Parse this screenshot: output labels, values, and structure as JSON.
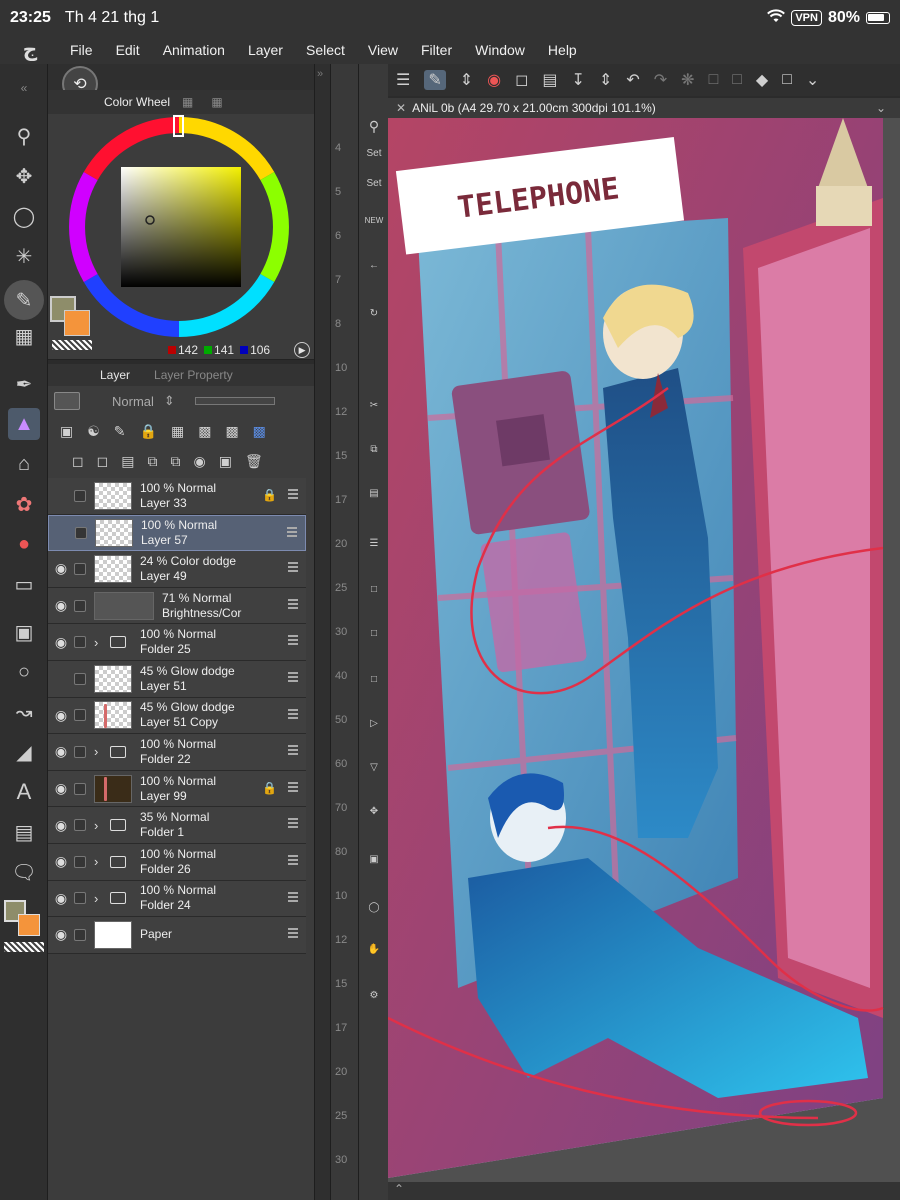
{
  "status": {
    "time": "23:25",
    "date": "Th 4 21 thg 1",
    "vpn": "VPN",
    "battery": "80%"
  },
  "menu": [
    "File",
    "Edit",
    "Animation",
    "Layer",
    "Select",
    "View",
    "Filter",
    "Window",
    "Help"
  ],
  "color_panel": {
    "tab": "Color Wheel",
    "rgb": {
      "r": "142",
      "g": "141",
      "b": "106"
    },
    "main_color": "#8e8d6a",
    "sub_color": "#f4943b"
  },
  "layer_panel": {
    "tab": "Layer",
    "tab2": "Layer Property",
    "blend_mode": "Normal",
    "layers": [
      {
        "line1": "100 % Normal",
        "line2": "Layer 33",
        "visible": false,
        "lock": true,
        "thumb": "checker"
      },
      {
        "line1": "100 % Normal",
        "line2": "Layer 57",
        "visible": false,
        "selected": true,
        "thumb": "checker"
      },
      {
        "line1": "24 % Color dodge",
        "line2": "Layer 49",
        "visible": true,
        "thumb": "checker"
      },
      {
        "line1": "71 % Normal",
        "line2": "Brightness/Cor",
        "visible": true,
        "thumb": "adjust"
      },
      {
        "line1": "100 % Normal",
        "line2": "Folder 25",
        "visible": true,
        "folder": true
      },
      {
        "line1": "45 % Glow dodge",
        "line2": "Layer 51",
        "visible": false,
        "thumb": "checker"
      },
      {
        "line1": "45 % Glow dodge",
        "line2": "Layer 51 Copy",
        "visible": true,
        "thumb": "checker",
        "red": true
      },
      {
        "line1": "100 % Normal",
        "line2": "Folder 22",
        "visible": true,
        "folder": true
      },
      {
        "line1": "100 % Normal",
        "line2": "Layer 99",
        "visible": true,
        "lock": true,
        "thumb": "dark",
        "red": true
      },
      {
        "line1": "35 % Normal",
        "line2": "Folder 1",
        "visible": true,
        "folder": true
      },
      {
        "line1": "100 % Normal",
        "line2": "Folder 26",
        "visible": true,
        "folder": true
      },
      {
        "line1": "100 % Normal",
        "line2": "Folder 24",
        "visible": true,
        "folder": true
      },
      {
        "line1": "",
        "line2": "Paper",
        "visible": true,
        "thumb": "plain"
      }
    ]
  },
  "gutter": {
    "numbers": [
      "4",
      "5",
      "6",
      "7",
      "8",
      "10",
      "12",
      "15",
      "17",
      "20",
      "25",
      "30",
      "40",
      "50",
      "60",
      "70",
      "80",
      "10",
      "12",
      "15",
      "17",
      "20",
      "25",
      "30"
    ]
  },
  "gutter3": {
    "btn1": "Set",
    "btn2": "Set",
    "btn3": "NEW"
  },
  "canvas": {
    "tab_title": "ANiL 0b (A4 29.70 x 21.00cm 300dpi 101.1%)",
    "sign_text": "TELEPHONE"
  }
}
